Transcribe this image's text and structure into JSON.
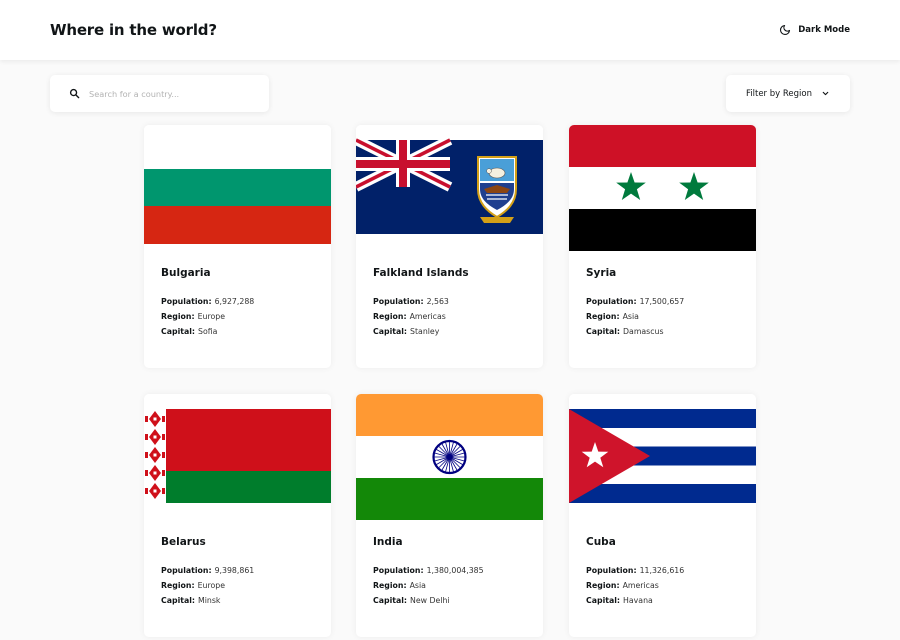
{
  "header": {
    "title": "Where in the world?",
    "dark_mode_label": "Dark Mode",
    "dark_mode_icon": "moon-icon"
  },
  "search": {
    "placeholder": "Search for a country...",
    "icon": "search-icon"
  },
  "filter": {
    "label": "Filter by Region",
    "icon": "chevron-down-icon"
  },
  "labels": {
    "population": "Population:",
    "region": "Region:",
    "capital": "Capital:"
  },
  "countries": [
    {
      "name": "Bulgaria",
      "population": "6,927,288",
      "region": "Europe",
      "capital": "Sofia",
      "flag_colors": [
        "#ffffff",
        "#00966e",
        "#d62612"
      ]
    },
    {
      "name": "Falkland Islands",
      "population": "2,563",
      "region": "Americas",
      "capital": "Stanley",
      "flag_colors": [
        "#012169",
        "#ffffff",
        "#c8102e"
      ]
    },
    {
      "name": "Syria",
      "population": "17,500,657",
      "region": "Asia",
      "capital": "Damascus",
      "flag_colors": [
        "#ce1126",
        "#ffffff",
        "#000000",
        "#007a3d"
      ]
    },
    {
      "name": "Belarus",
      "population": "9,398,861",
      "region": "Europe",
      "capital": "Minsk",
      "flag_colors": [
        "#cf101a",
        "#007d2c",
        "#ffffff"
      ]
    },
    {
      "name": "India",
      "population": "1,380,004,385",
      "region": "Asia",
      "capital": "New Delhi",
      "flag_colors": [
        "#ff9933",
        "#ffffff",
        "#138808",
        "#000080"
      ]
    },
    {
      "name": "Cuba",
      "population": "11,326,616",
      "region": "Americas",
      "capital": "Havana",
      "flag_colors": [
        "#002a8f",
        "#ffffff",
        "#cf142b"
      ]
    }
  ]
}
